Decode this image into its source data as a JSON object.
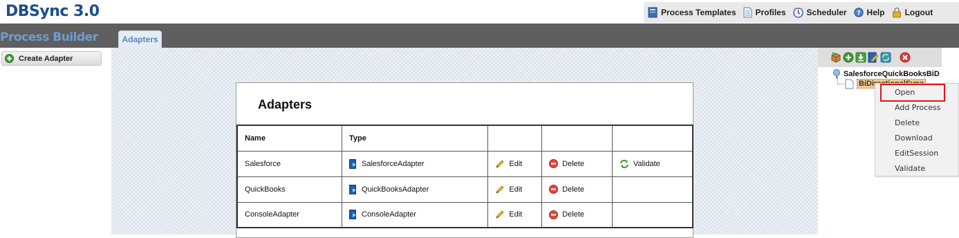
{
  "app": {
    "title": "DBSync 3.0"
  },
  "top_nav": {
    "items": [
      {
        "label": "Process Templates",
        "icon": "book-icon"
      },
      {
        "label": "Profiles",
        "icon": "document-icon"
      },
      {
        "label": "Scheduler",
        "icon": "clock-icon"
      },
      {
        "label": "Help",
        "icon": "help-icon"
      },
      {
        "label": "Logout",
        "icon": "lock-icon"
      }
    ]
  },
  "main_bar": {
    "section_title": "Process Builder",
    "tabs": [
      {
        "label": "Adapters"
      }
    ]
  },
  "left_panel": {
    "create_button_label": "Create Adapter"
  },
  "adapters": {
    "heading": "Adapters",
    "columns": [
      "Name",
      "Type",
      "",
      "",
      ""
    ],
    "rows": [
      {
        "name": "Salesforce",
        "type": "SalesforceAdapter",
        "edit": "Edit",
        "delete": "Delete",
        "validate": "Validate"
      },
      {
        "name": "QuickBooks",
        "type": "QuickBooksAdapter",
        "edit": "Edit",
        "delete": "Delete",
        "validate": ""
      },
      {
        "name": "ConsoleAdapter",
        "type": "ConsoleAdapter",
        "edit": "Edit",
        "delete": "Delete",
        "validate": ""
      }
    ]
  },
  "right_panel": {
    "toolbar_icons": [
      "package-icon",
      "add-icon",
      "download-icon",
      "edit-session-icon",
      "refresh-icon",
      "close-icon"
    ],
    "tree": {
      "root_label": "SalesforceQuickBooksBiD",
      "child_label": "BiDirectionalSync"
    },
    "context_menu": {
      "items": [
        "Open",
        "Add Process",
        "Delete",
        "Download",
        "EditSession",
        "Validate"
      ]
    }
  },
  "colors": {
    "brand_blue": "#1a4f8b",
    "header_bar": "#5f5f5f",
    "highlight_red": "#e0151b",
    "tree_selection": "#f5c98a"
  }
}
